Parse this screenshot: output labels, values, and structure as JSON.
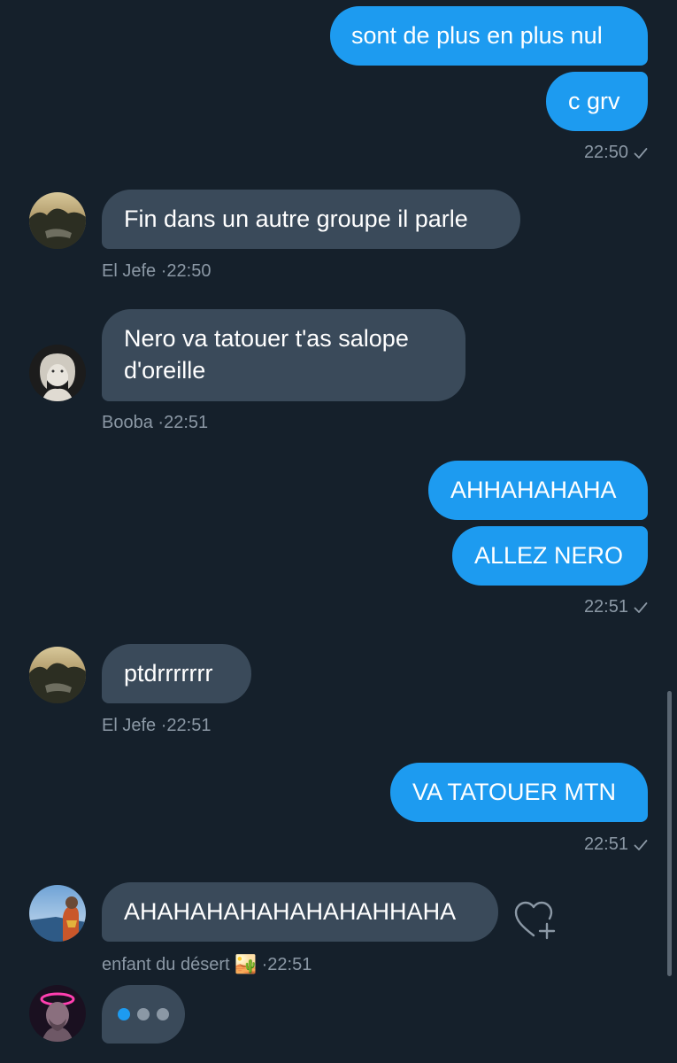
{
  "colors": {
    "background": "#15202b",
    "outgoing_bubble": "#1d9bf0",
    "incoming_bubble": "#3a4a5a",
    "meta_text": "#8b98a5"
  },
  "messages": {
    "m1": "sont de plus en plus nul",
    "m2": "c grv",
    "m2_time": "22:50",
    "m3": "Fin dans un autre groupe il parle",
    "m3_sender": "El Jefe",
    "m3_time": "22:50",
    "m4_line1": "Nero va tatouer t'as salope",
    "m4_line2": "d'oreille",
    "m4_sender": "Booba",
    "m4_time": "22:51",
    "m5": "AHHAHAHAHA",
    "m6": "ALLEZ NERO",
    "m6_time": "22:51",
    "m7": "ptdrrrrrrr",
    "m7_sender": "El Jefe",
    "m7_time": "22:51",
    "m8": "VA TATOUER MTN",
    "m8_time": "22:51",
    "m9": "AHAHAHAHAHAHAHAHHAHA",
    "m9_sender": "enfant du désert",
    "m9_sender_emoji": "🏜️",
    "m9_time": "22:51"
  },
  "separator": "·",
  "icons": {
    "sent_status": "checkmark-icon",
    "react": "heart-plus-icon",
    "typing": "typing-indicator-icon"
  }
}
